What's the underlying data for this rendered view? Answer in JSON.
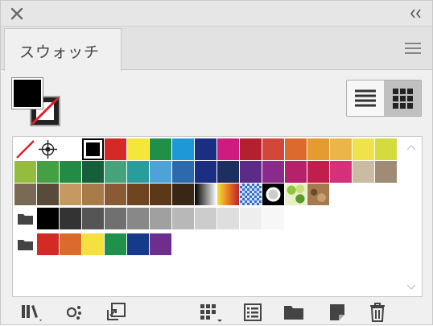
{
  "panel": {
    "tab_label": "スウォッチ"
  },
  "icons": {
    "close": "close-icon",
    "collapse": "double-chevron-left-icon",
    "menu": "hamburger-menu-icon",
    "list_view": "list-view-icon",
    "grid_view": "grid-view-icon",
    "bottom": [
      "swatch-libraries-icon",
      "place-swatches-icon",
      "import-swatch-icon",
      "show-swatch-kinds-icon",
      "swatch-options-icon",
      "new-color-group-icon",
      "new-swatch-icon",
      "delete-swatch-icon"
    ]
  },
  "colors": {
    "row1": [
      "none",
      "registration",
      "#ffffff",
      "#000000",
      "#d42a26",
      "#f5e63a",
      "#1f8f4a",
      "#1e98d7",
      "#1a2f82",
      "#cf1b7f",
      "#b32030",
      "#d3473b",
      "#dd6a2d",
      "#e59b30",
      "#ebb54a",
      "#f0e24a",
      "#d5da3f"
    ],
    "row2": [
      "#94bd3f",
      "#44a045",
      "#238b45",
      "#175f3a",
      "#46a27a",
      "#2a9c9c",
      "#4fa2d6",
      "#2c6aae",
      "#1a2f82",
      "#1d2f5e",
      "#5c2a87",
      "#8a2a8a",
      "#b3226a",
      "#c01f4e",
      "#d5307a",
      "#c9bca0",
      "#a08b76"
    ],
    "row3": [
      "#7a6a55",
      "#5a4a3a",
      "#c49a62",
      "#a87c48",
      "#8a5a32",
      "#6e4520",
      "#5a3818",
      "#3a2614",
      "grad-bw",
      "grad-orange",
      "pattern-check",
      "pattern-circle",
      "pattern-leaves",
      "pattern-texture"
    ],
    "group1": [
      "#000000",
      "#333333",
      "#555555",
      "#707070",
      "#888888",
      "#a0a0a0",
      "#b8b8b8",
      "#cccccc",
      "#dedede",
      "#eeeeee",
      "#f7f7f7"
    ],
    "group2": [
      "#d42a26",
      "#dd6a2d",
      "#f5e040",
      "#20914a",
      "#153a8a",
      "#6e2e8e"
    ]
  }
}
